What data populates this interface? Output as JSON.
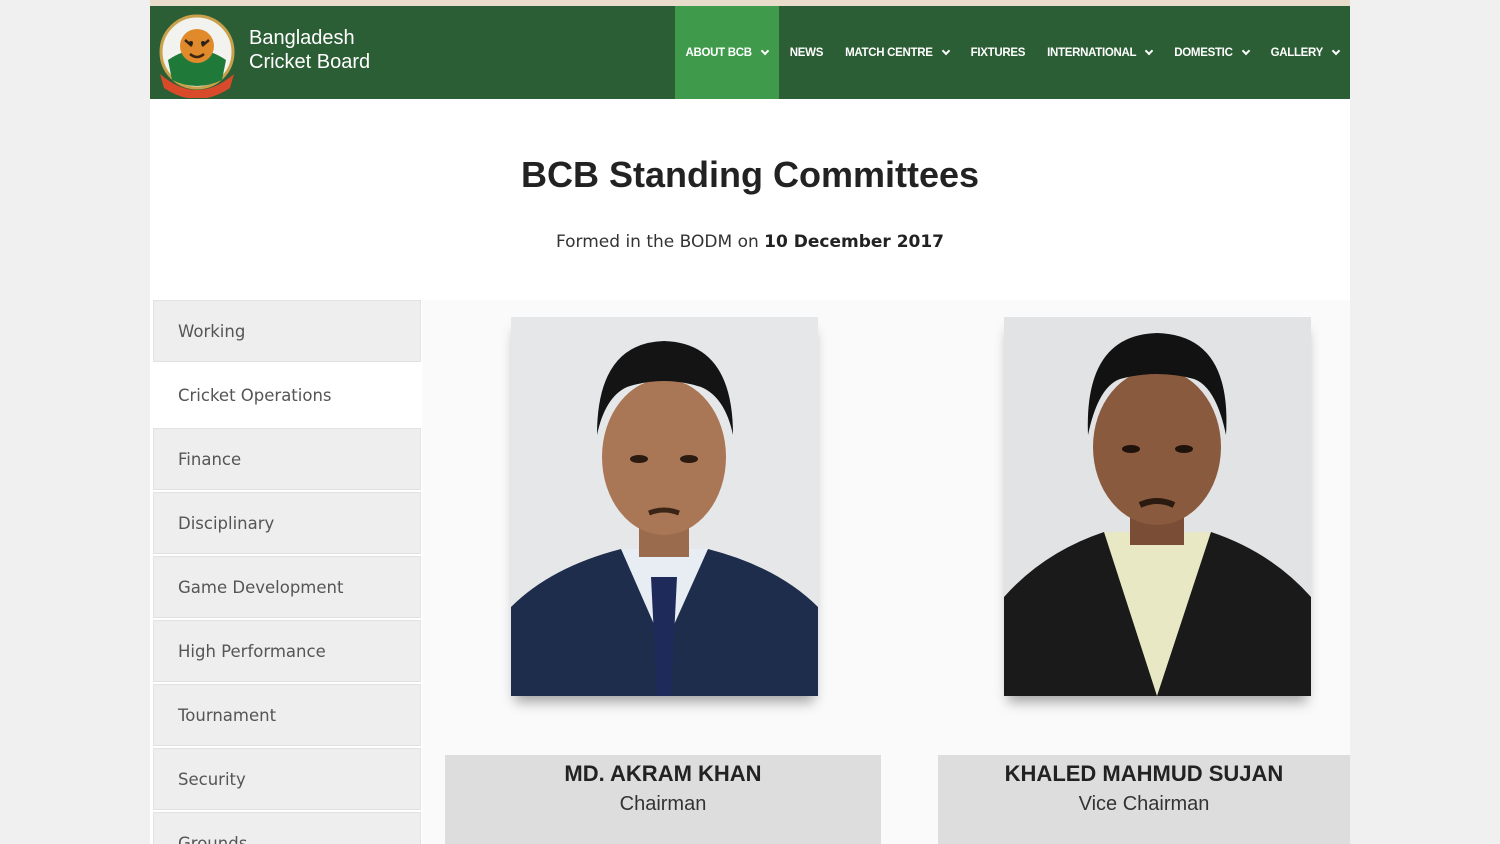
{
  "header": {
    "brand_line1": "Bangladesh",
    "brand_line2": "Cricket Board",
    "nav": [
      {
        "label": "ABOUT BCB",
        "dropdown": true,
        "active": true
      },
      {
        "label": "NEWS",
        "dropdown": false
      },
      {
        "label": "MATCH CENTRE",
        "dropdown": true
      },
      {
        "label": "FIXTURES",
        "dropdown": false
      },
      {
        "label": "INTERNATIONAL",
        "dropdown": true
      },
      {
        "label": "DOMESTIC",
        "dropdown": true
      },
      {
        "label": "GALLERY",
        "dropdown": true
      }
    ]
  },
  "page": {
    "title": "BCB Standing Committees",
    "subtitle_prefix": "Formed in the BODM on",
    "subtitle_date": "10 December 2017"
  },
  "sidebar": {
    "items": [
      {
        "label": "Working"
      },
      {
        "label": "Cricket Operations",
        "active": true
      },
      {
        "label": "Finance"
      },
      {
        "label": "Disciplinary"
      },
      {
        "label": "Game Development"
      },
      {
        "label": "High Performance"
      },
      {
        "label": "Tournament"
      },
      {
        "label": "Security"
      },
      {
        "label": "Grounds"
      }
    ]
  },
  "members": [
    {
      "name": "MD. AKRAM KHAN",
      "role": "Chairman"
    },
    {
      "name": "KHALED MAHMUD SUJAN",
      "role": "Vice Chairman"
    }
  ],
  "colors": {
    "header_bg": "#2c5e35",
    "nav_active": "#3f9a4b"
  }
}
